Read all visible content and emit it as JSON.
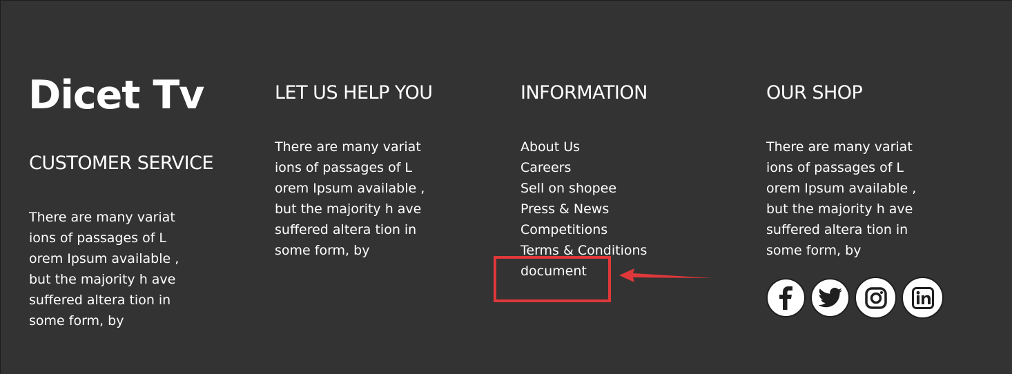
{
  "brand": {
    "logo_text": "Dicet Tv"
  },
  "customer_service": {
    "heading": "CUSTOMER SERVICE",
    "lines": [
      "There are many variat",
      "ions of passages of L",
      "orem Ipsum available ,",
      "but the majority h ave",
      "suffered altera tion in",
      "some form, by"
    ]
  },
  "help": {
    "heading": "LET US HELP YOU",
    "lines": [
      "There are many variat",
      "ions of passages of L",
      "orem Ipsum available ,",
      "but the majority h ave",
      "suffered altera tion in",
      "some form, by"
    ]
  },
  "information": {
    "heading": "INFORMATION",
    "links": [
      "About Us",
      "Careers",
      "Sell on shopee",
      "Press & News",
      "Competitions",
      "Terms & Conditions",
      "document"
    ]
  },
  "shop": {
    "heading": "OUR SHOP",
    "lines": [
      "There are many variat",
      "ions of passages of L",
      "orem Ipsum available ,",
      "but the majority h ave",
      "suffered altera tion in",
      "some form, by"
    ],
    "social": [
      {
        "icon": "facebook-icon"
      },
      {
        "icon": "twitter-icon"
      },
      {
        "icon": "instagram-icon"
      },
      {
        "icon": "linkedin-icon"
      }
    ]
  },
  "annotation": {
    "highlight_color": "#e0383a"
  },
  "colors": {
    "background": "#333333",
    "text": "#ffffff"
  }
}
